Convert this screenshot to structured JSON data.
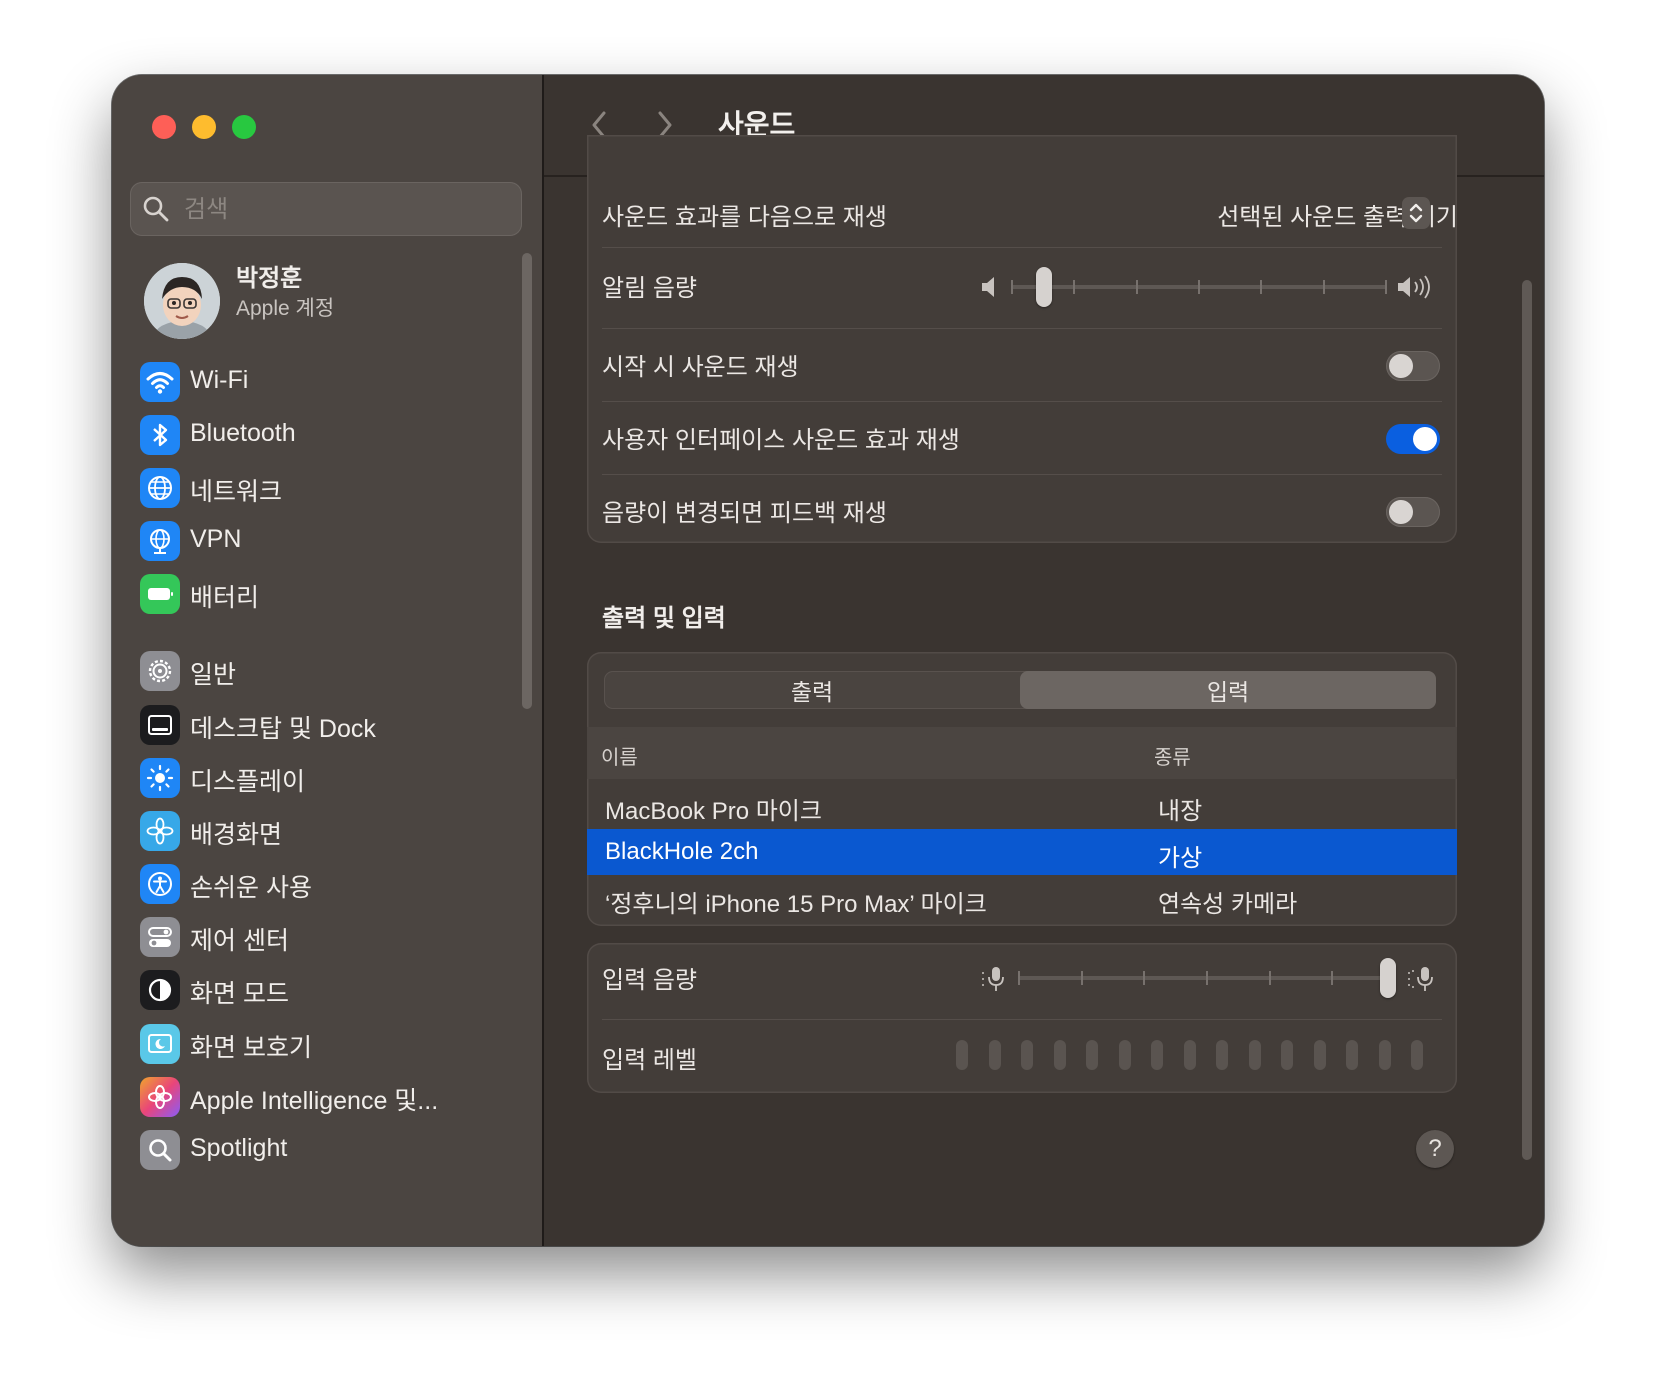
{
  "window": {
    "title": "사운드"
  },
  "sidebar": {
    "search_placeholder": "검색",
    "account": {
      "name": "박정훈",
      "subtitle": "Apple 계정"
    },
    "items": [
      {
        "label": "Wi-Fi",
        "icon": "wifi-icon",
        "color": "#1f86f6"
      },
      {
        "label": "Bluetooth",
        "icon": "bluetooth-icon",
        "color": "#1f86f6"
      },
      {
        "label": "네트워크",
        "icon": "globe-icon",
        "color": "#1f86f6"
      },
      {
        "label": "VPN",
        "icon": "vpn-globe-icon",
        "color": "#1f86f6"
      },
      {
        "label": "배터리",
        "icon": "battery-icon",
        "color": "#34c759"
      },
      {
        "label": "일반",
        "icon": "gear-icon",
        "color": "#8e8e93"
      },
      {
        "label": "데스크탑 및 Dock",
        "icon": "dock-icon",
        "color": "#1c1c1e"
      },
      {
        "label": "디스플레이",
        "icon": "sun-icon",
        "color": "#1f86f6"
      },
      {
        "label": "배경화면",
        "icon": "flower-icon",
        "color": "#37a8e8"
      },
      {
        "label": "손쉬운 사용",
        "icon": "accessibility-icon",
        "color": "#1f86f6"
      },
      {
        "label": "제어 센터",
        "icon": "control-center-icon",
        "color": "#8e8e93"
      },
      {
        "label": "화면 모드",
        "icon": "appearance-icon",
        "color": "#1c1c1e"
      },
      {
        "label": "화면 보호기",
        "icon": "screensaver-icon",
        "color": "#5ac8e8"
      },
      {
        "label": "Apple Intelligence 및...",
        "icon": "apple-intelligence-icon",
        "color": "#f0702d"
      },
      {
        "label": "Spotlight",
        "icon": "spotlight-icon",
        "color": "#8e8e93"
      }
    ]
  },
  "sound_effects": {
    "play_through_label": "사운드 효과를 다음으로 재생",
    "play_through_value": "선택된 사운드 출력 기기",
    "alert_volume_label": "알림 음량",
    "alert_volume_level": 0.07,
    "startup_sound_label": "시작 시 사운드 재생",
    "startup_sound_on": false,
    "ui_sound_label": "사용자 인터페이스 사운드 효과 재생",
    "ui_sound_on": true,
    "feedback_label": "음량이 변경되면 피드백 재생",
    "feedback_on": false
  },
  "output_input": {
    "section_title": "출력 및 입력",
    "tabs": [
      {
        "label": "출력"
      },
      {
        "label": "입력"
      }
    ],
    "selected_tab": "입력",
    "columns": {
      "name": "이름",
      "type": "종류"
    },
    "devices": [
      {
        "name": "MacBook Pro 마이크",
        "type": "내장",
        "selected": false
      },
      {
        "name": "BlackHole 2ch",
        "type": "가상",
        "selected": true
      },
      {
        "name": "‘정후니의 iPhone 15 Pro Max’ 마이크",
        "type": "연속성 카메라",
        "selected": false
      }
    ]
  },
  "input": {
    "volume_label": "입력 음량",
    "volume_level": 1.0,
    "level_label": "입력 레벨",
    "level_value": 0
  },
  "colors": {
    "accent": "#0a5fe0",
    "selection": "#0a58d0"
  }
}
